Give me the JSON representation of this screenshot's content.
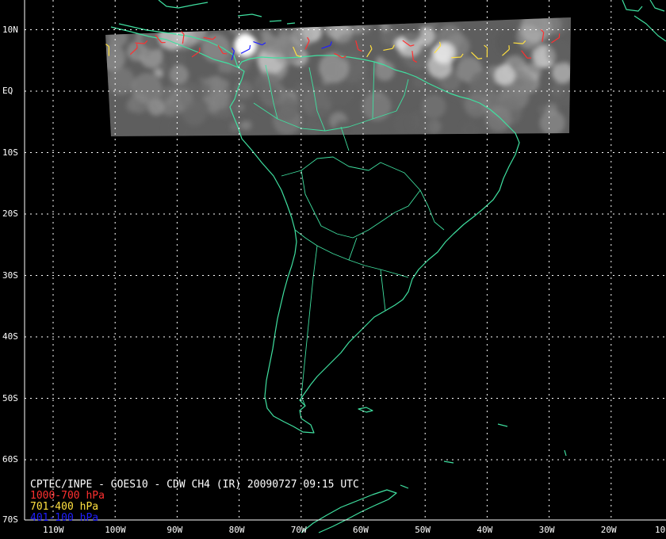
{
  "map": {
    "title": "CPTEC/INPE - GOES10 - CDW CH4 (IR) 20090727 09:15 UTC",
    "colors": {
      "background": "#000000",
      "coastline": "#3fe0a0",
      "grid": "#ffffff",
      "frame": "#ffffff",
      "layer_low": "#ff3030",
      "layer_mid": "#ffe040",
      "layer_high": "#2020ff"
    },
    "legend": [
      {
        "label": "1000-700 hPa",
        "color": "#ff3030"
      },
      {
        "label": "701-400 hPa",
        "color": "#ffe040"
      },
      {
        "label": "401-100 hPa",
        "color": "#2020ff"
      }
    ],
    "lat_labels": [
      "10N",
      "EQ",
      "10S",
      "20S",
      "30S",
      "40S",
      "50S",
      "60S",
      "70S"
    ],
    "lon_labels": [
      "110W",
      "100W",
      "90W",
      "80W",
      "70W",
      "60W",
      "50W",
      "40W",
      "30W",
      "20W",
      "10"
    ],
    "satellite_swath": {
      "lat_range": [
        -7,
        9
      ],
      "lon_range": [
        -104,
        -27
      ]
    },
    "wind_barbs": [
      {
        "lon": -101,
        "lat": 6.5,
        "level": "mid"
      },
      {
        "lon": -97,
        "lat": 6.5,
        "level": "low"
      },
      {
        "lon": -96,
        "lat": 7.8,
        "level": "low"
      },
      {
        "lon": -93,
        "lat": 8.5,
        "level": "low"
      },
      {
        "lon": -89,
        "lat": 8.5,
        "level": "low"
      },
      {
        "lon": -87,
        "lat": 6,
        "level": "low"
      },
      {
        "lon": -85,
        "lat": 8.6,
        "level": "low"
      },
      {
        "lon": -83,
        "lat": 6.8,
        "level": "low"
      },
      {
        "lon": -81,
        "lat": 5.8,
        "level": "high"
      },
      {
        "lon": -79,
        "lat": 6.5,
        "level": "high"
      },
      {
        "lon": -77,
        "lat": 7.8,
        "level": "high"
      },
      {
        "lon": -71,
        "lat": 6.5,
        "level": "mid"
      },
      {
        "lon": -69,
        "lat": 7.5,
        "level": "low"
      },
      {
        "lon": -66,
        "lat": 7.2,
        "level": "high"
      },
      {
        "lon": -64,
        "lat": 5.8,
        "level": "low"
      },
      {
        "lon": -61,
        "lat": 7.5,
        "level": "low"
      },
      {
        "lon": -59,
        "lat": 6.2,
        "level": "mid"
      },
      {
        "lon": -56,
        "lat": 6.8,
        "level": "mid"
      },
      {
        "lon": -53,
        "lat": 7.8,
        "level": "low"
      },
      {
        "lon": -52,
        "lat": 5.8,
        "level": "low"
      },
      {
        "lon": -48,
        "lat": 6.8,
        "level": "mid"
      },
      {
        "lon": -45,
        "lat": 5.5,
        "level": "mid"
      },
      {
        "lon": -42,
        "lat": 5.8,
        "level": "mid"
      },
      {
        "lon": -40,
        "lat": 6.3,
        "level": "mid"
      },
      {
        "lon": -37,
        "lat": 6.3,
        "level": "mid"
      },
      {
        "lon": -35,
        "lat": 7.8,
        "level": "mid"
      },
      {
        "lon": -34,
        "lat": 6,
        "level": "low"
      },
      {
        "lon": -31,
        "lat": 8.8,
        "level": "low"
      },
      {
        "lon": -29,
        "lat": 8.3,
        "level": "low"
      }
    ]
  }
}
